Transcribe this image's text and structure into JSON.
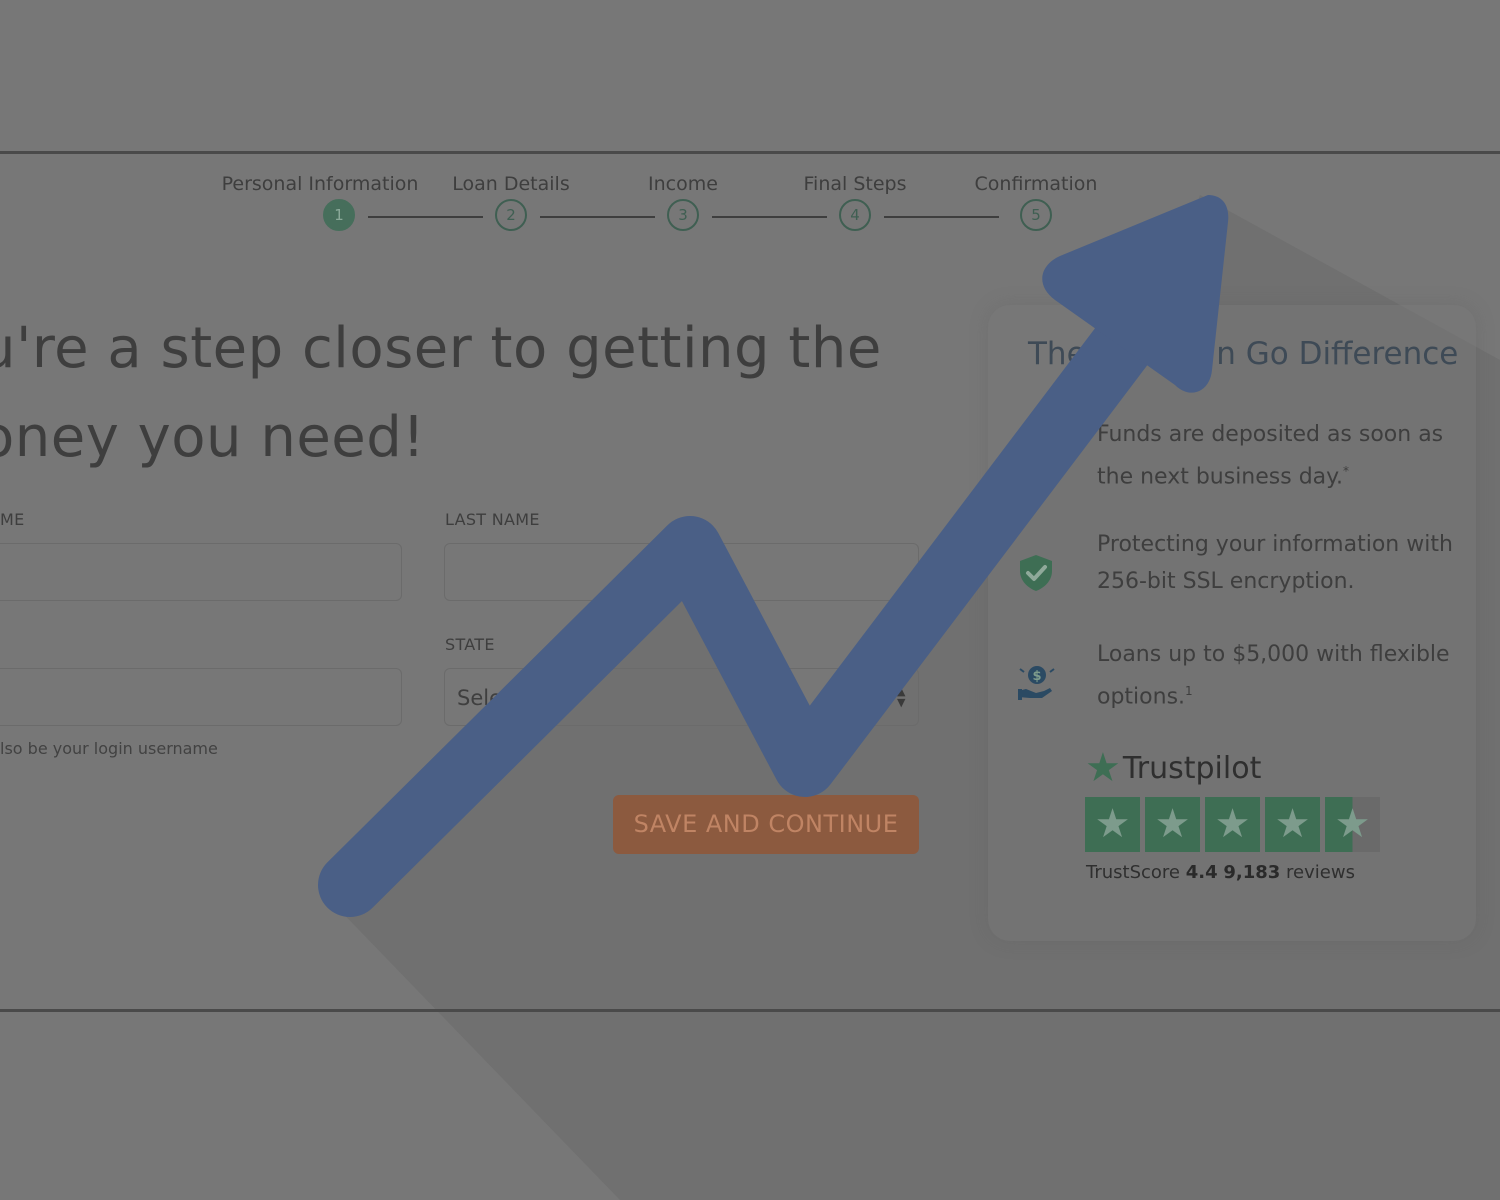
{
  "stepper": {
    "steps": [
      {
        "label": "Personal Information",
        "number": "1"
      },
      {
        "label": "Loan Details",
        "number": "2"
      },
      {
        "label": "Income",
        "number": "3"
      },
      {
        "label": "Final Steps",
        "number": "4"
      },
      {
        "label": "Confirmation",
        "number": "5"
      }
    ],
    "active_step": 1
  },
  "main": {
    "heading_line1": "u're a step closer to getting the",
    "heading_line2": "oney you need!",
    "form": {
      "first_name_label": "ME",
      "last_name_label": "LAST NAME",
      "state_label": "STATE",
      "state_value": "Select",
      "email_helper": "lso be your login username"
    },
    "save_button": "SAVE AND CONTINUE"
  },
  "sidebar": {
    "title": "The Check `n Go Difference",
    "features": [
      {
        "icon": "rocket-icon",
        "text": "Funds are deposited as soon as the next business day.",
        "sup": "*"
      },
      {
        "icon": "shield-check-icon",
        "text": "Protecting your information with 256-bit SSL encryption.",
        "sup": ""
      },
      {
        "icon": "hand-money-icon",
        "text": "Loans up to $5,000 with flexible options.",
        "sup": "1"
      }
    ]
  },
  "trustpilot": {
    "brand": "Trustpilot",
    "trustscore_label": "TrustScore",
    "score": "4.4",
    "review_count": "9,183",
    "reviews_label": "reviews",
    "stars_rating": 4.5
  },
  "colors": {
    "overlay_background": "#777777",
    "arrow_blue": "#4a5f86",
    "step_green": "#466e5b",
    "button_orange": "#8c5a3f",
    "trustpilot_green": "#3e6e54"
  }
}
